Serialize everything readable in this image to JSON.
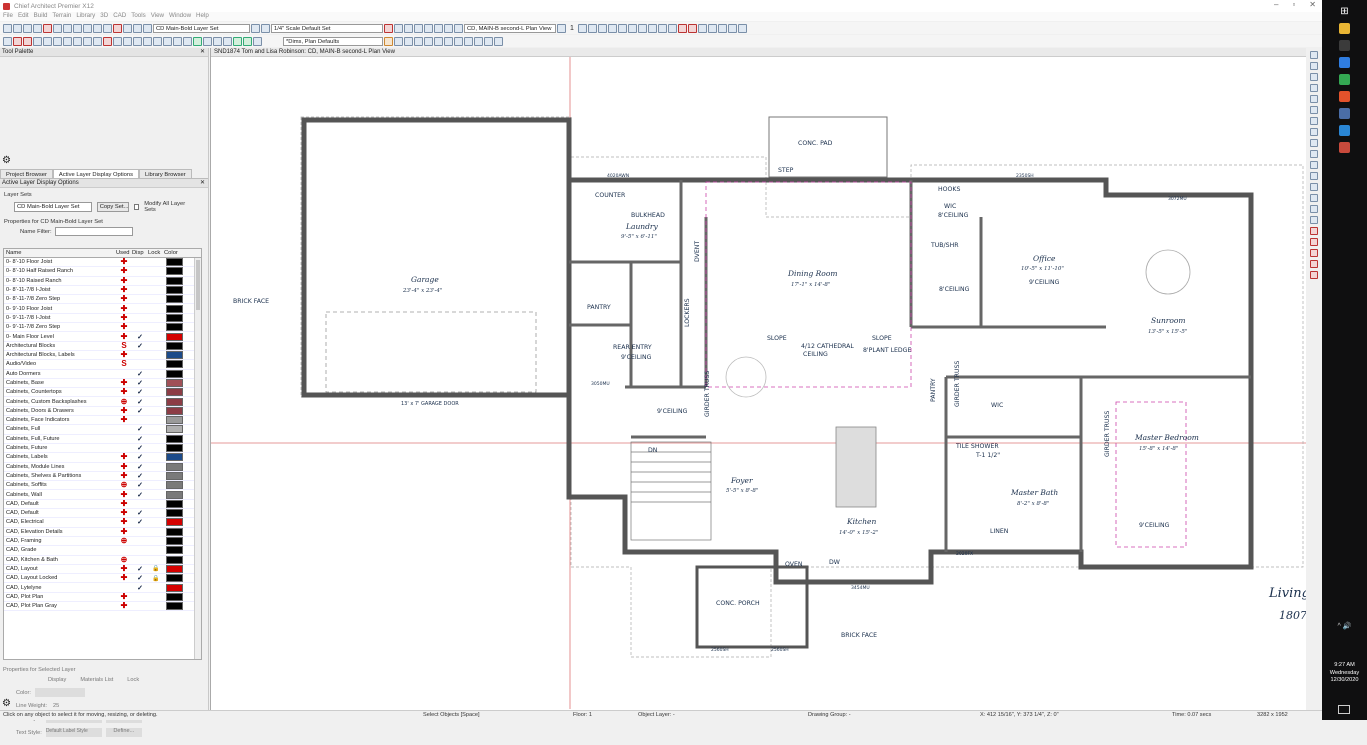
{
  "app": {
    "title": "Chief Architect Premier X12",
    "window_controls": [
      "–",
      "▫",
      "✕"
    ]
  },
  "menu": [
    "File",
    "Edit",
    "Build",
    "Terrain",
    "Library",
    "3D",
    "CAD",
    "Tools",
    "View",
    "Window",
    "Help"
  ],
  "toolbar": {
    "layer_set": "CD Main-Bold Layer Set",
    "scale": "1/4\" Scale Default Set",
    "plan_view": "CD, MAIN-B second-L Plan View",
    "dims": "*Dims, Plan Defaults",
    "floor_num": "1"
  },
  "left_panel": {
    "tool_palette_title": "Tool Palette",
    "tabs": [
      "Project Browser",
      "Active Layer Display Options",
      "Library Browser"
    ],
    "active_title": "Active Layer Display Options",
    "layer_sets_label": "Layer Sets",
    "layer_set_value": "CD Main-Bold Layer Set",
    "copy_set_btn": "Copy Set...",
    "modify_all_label": "Modify All Layer Sets",
    "props_for_label": "Properties for CD Main-Bold Layer Set",
    "name_filter_label": "Name Filter:",
    "columns": [
      "Name",
      "Used",
      "Disp",
      "Lock",
      "Color"
    ],
    "layers": [
      {
        "name": "0- 8'-10 Floor Joist",
        "used": "✚",
        "disp": "",
        "lock": "",
        "color": "#000000"
      },
      {
        "name": "0- 8'-10 Half Raised Ranch",
        "used": "✚",
        "disp": "",
        "lock": "",
        "color": "#000000"
      },
      {
        "name": "0- 8'-10 Raised Ranch",
        "used": "✚",
        "disp": "",
        "lock": "",
        "color": "#000000"
      },
      {
        "name": "0- 8'-11-7/8 I-Joist",
        "used": "✚",
        "disp": "",
        "lock": "",
        "color": "#000000"
      },
      {
        "name": "0- 8'-11-7/8 Zero Step",
        "used": "✚",
        "disp": "",
        "lock": "",
        "color": "#000000"
      },
      {
        "name": "0- 9'-10 Floor Joist",
        "used": "✚",
        "disp": "",
        "lock": "",
        "color": "#000000"
      },
      {
        "name": "0- 9'-11-7/8 I-Joist",
        "used": "✚",
        "disp": "",
        "lock": "",
        "color": "#000000"
      },
      {
        "name": "0- 9'-11-7/8 Zero Step",
        "used": "✚",
        "disp": "",
        "lock": "",
        "color": "#000000"
      },
      {
        "name": "0- Main Floor Level",
        "used": "✚",
        "disp": "✓",
        "lock": "",
        "color": "#d40000"
      },
      {
        "name": "Architectural Blocks",
        "used": "S",
        "disp": "✓",
        "lock": "",
        "color": "#000000"
      },
      {
        "name": "Architectural Blocks, Labels",
        "used": "✚",
        "disp": "",
        "lock": "",
        "color": "#1c4a8a"
      },
      {
        "name": "Audio/Video",
        "used": "S",
        "disp": "",
        "lock": "",
        "color": "#000000"
      },
      {
        "name": "Auto Dormers",
        "used": "",
        "disp": "✓",
        "lock": "",
        "color": "#000000"
      },
      {
        "name": "Cabinets, Base",
        "used": "✚",
        "disp": "✓",
        "lock": "",
        "color": "#a05058"
      },
      {
        "name": "Cabinets, Countertops",
        "used": "✚",
        "disp": "✓",
        "lock": "",
        "color": "#8c3c46"
      },
      {
        "name": "Cabinets, Custom Backsplashes",
        "used": "⊕",
        "disp": "✓",
        "lock": "",
        "color": "#8c3c46"
      },
      {
        "name": "Cabinets, Doors & Drawers",
        "used": "✚",
        "disp": "✓",
        "lock": "",
        "color": "#8c3c46"
      },
      {
        "name": "Cabinets, Face Indicators",
        "used": "✚",
        "disp": "",
        "lock": "",
        "color": "#9a9a9a"
      },
      {
        "name": "Cabinets, Full",
        "used": "",
        "disp": "✓",
        "lock": "",
        "color": "#b0b0b0"
      },
      {
        "name": "Cabinets, Full, Future",
        "used": "",
        "disp": "✓",
        "lock": "",
        "color": "#000000"
      },
      {
        "name": "Cabinets, Future",
        "used": "",
        "disp": "✓",
        "lock": "",
        "color": "#000000"
      },
      {
        "name": "Cabinets, Labels",
        "used": "✚",
        "disp": "✓",
        "lock": "",
        "color": "#1c4a8a"
      },
      {
        "name": "Cabinets, Module Lines",
        "used": "✚",
        "disp": "✓",
        "lock": "",
        "color": "#7a7a7a"
      },
      {
        "name": "Cabinets, Shelves & Partitions",
        "used": "✚",
        "disp": "✓",
        "lock": "",
        "color": "#7a7a7a"
      },
      {
        "name": "Cabinets, Soffits",
        "used": "⊕",
        "disp": "✓",
        "lock": "",
        "color": "#7a7a7a"
      },
      {
        "name": "Cabinets, Wall",
        "used": "✚",
        "disp": "✓",
        "lock": "",
        "color": "#7a7a7a"
      },
      {
        "name": "CAD, Default",
        "used": "✚",
        "disp": "",
        "lock": "",
        "color": "#000000"
      },
      {
        "name": "CAD, Default",
        "used": "✚",
        "disp": "✓",
        "lock": "",
        "color": "#000000"
      },
      {
        "name": "CAD, Electrical",
        "used": "✚",
        "disp": "✓",
        "lock": "",
        "color": "#d40000"
      },
      {
        "name": "CAD, Elevation Details",
        "used": "✚",
        "disp": "",
        "lock": "",
        "color": "#000000"
      },
      {
        "name": "CAD, Framing",
        "used": "⊕",
        "disp": "",
        "lock": "",
        "color": "#000000"
      },
      {
        "name": "CAD, Grade",
        "used": "",
        "disp": "",
        "lock": "",
        "color": "#000000"
      },
      {
        "name": "CAD, Kitchen & Bath",
        "used": "⊕",
        "disp": "",
        "lock": "",
        "color": "#000000"
      },
      {
        "name": "CAD, Layout",
        "used": "✚",
        "disp": "✓",
        "lock": "🔒",
        "color": "#d40000"
      },
      {
        "name": "CAD, Layout Locked",
        "used": "✚",
        "disp": "✓",
        "lock": "🔒",
        "color": "#000000"
      },
      {
        "name": "CAD, Lytelyne",
        "used": "",
        "disp": "✓",
        "lock": "",
        "color": "#d40000"
      },
      {
        "name": "CAD, Plot Plan",
        "used": "✚",
        "disp": "",
        "lock": "",
        "color": "#000000"
      },
      {
        "name": "CAD, Plot Plan Gray",
        "used": "✚",
        "disp": "",
        "lock": "",
        "color": "#000000"
      }
    ],
    "props_selected_label": "Properties for Selected Layer",
    "display_label": "Display",
    "materials_label": "Materials List",
    "lock_label": "Lock",
    "color_label": "Color:",
    "line_weight_label": "Line Weight:",
    "line_weight_value": "25",
    "line_style_label": "Line Style:",
    "library_btn": "Library...",
    "text_style_label": "Text Style:",
    "text_style_value": "Default Label Style",
    "define_btn": "Define..."
  },
  "canvas": {
    "header": "SND1874 Tom and Lisa Robinson: CD, MAIN-B second-L Plan View",
    "labels": {
      "garage": "Garage",
      "garage_dim": "23'-4\" x 23'-4\"",
      "garage_door": "13' x 7' GARAGE DOOR",
      "brick_face": "BRICK FACE",
      "brick_face2": "BRICK FACE",
      "counter": "COUNTER",
      "laundry": "Laundry",
      "laundry_dim": "9'-5\" x 6'-11\"",
      "bulkhead": "BULKHEAD",
      "pantry": "PANTRY",
      "pantry2": "PANTRY",
      "lockers": "LOCKERS",
      "dvent": "DVENT",
      "rear_entry": "REAR ENTRY",
      "ceiling9": "9'CEILING",
      "ceiling9b": "9'CEILING",
      "girder": "GIRDER TRUSS",
      "girder2": "GIRDER TRUSS",
      "girder3": "GIRDER TRUSS",
      "dining": "Dining Room",
      "dining_dim": "17'-1\" x 14'-8\"",
      "slope": "SLOPE",
      "slope2": "SLOPE",
      "cathedral": "4/12 CATHEDRAL",
      "cathedral2": "CEILING",
      "plant_ledge": "8'PLANT LEDGE",
      "conc_pad": "CONC. PAD",
      "step": "STEP",
      "hooks": "HOOKS",
      "wic": "WIC",
      "wic_ceil": "8'CEILING",
      "wic2": "WIC",
      "tubshr": "TUB/SHR",
      "bath_ceil": "8'CEILING",
      "office": "Office",
      "office_dim": "10'-5\" x 11'-10\"",
      "office_ceil": "9'CEILING",
      "sunroom": "Sunroom",
      "sunroom_dim": "13'-5\" x 15'-5\"",
      "dn": "DN",
      "foyer": "Foyer",
      "foyer_dim": "5'-5\" x 8'-8\"",
      "kitchen": "Kitchen",
      "kitchen_dim": "14'-0\" x 15'-2\"",
      "tile_shower": "TILE SHOWER",
      "ceil_th": "T-1 1/2\"",
      "master_bath": "Master Bath",
      "master_bath_dim": "8'-2\" x 8'-8\"",
      "linen": "LINEN",
      "master_bed": "Master Bedroom",
      "master_bed_dim": "15'-8\" x 14'-8\"",
      "master_ceil": "9'CEILING",
      "oven": "OVEN",
      "dw": "DW",
      "conc_porch": "CONC. PORCH",
      "living": "Living",
      "living_num": "1807",
      "dim1": "4020AWN",
      "dim2": "3050MU",
      "dim3": "2350SH",
      "dim4": "3072MU",
      "dim5": "2560SH",
      "dim6": "2560SH",
      "dim7": "3454MU",
      "dim8": "2020FX"
    }
  },
  "status": {
    "hint": "Click on any object to select it for moving, resizing, or deleting.",
    "mode": "Select Objects [Space]",
    "floor": "Floor: 1",
    "object_layer": "Object Layer: -",
    "drawing_group": "Drawing Group: -",
    "coords": "X: 412 15/16\", Y: 373 1/4\", Z: 0\"",
    "time": "Time: 0.07 secs",
    "size": "3282 x 1952"
  },
  "taskbar": {
    "time": "9:27 AM",
    "day": "Wednesday",
    "date": "12/30/2020",
    "icons": [
      "windows-icon",
      "file-explorer-icon",
      "calculator-icon",
      "photoshop-icon",
      "chrome-icon",
      "brave-icon",
      "chief-architect-icon",
      "acrobat-icon",
      "vivaldi-icon"
    ],
    "icon_colors": [
      "#0f0f10",
      "#e8b534",
      "#3b3b3b",
      "#2f7de1",
      "#34a853",
      "#e2522b",
      "#4a6da7",
      "#2a86d4",
      "#c84a3c"
    ]
  }
}
